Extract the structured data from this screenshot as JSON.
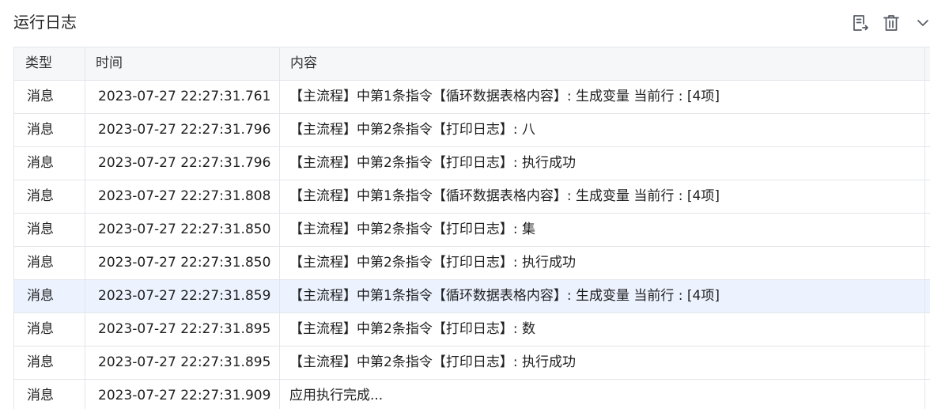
{
  "panel": {
    "title": "运行日志"
  },
  "toolbar": {
    "export_icon": "export-log-icon",
    "delete_icon": "trash-icon",
    "collapse_icon": "chevron-down-icon"
  },
  "table": {
    "columns": [
      "类型",
      "时间",
      "内容"
    ],
    "hover_row_index": 6,
    "rows": [
      {
        "type": "消息",
        "time": "2023-07-27 22:27:31.761",
        "content": "【主流程】中第1条指令【循环数据表格内容】: 生成变量 当前行 : [4项]"
      },
      {
        "type": "消息",
        "time": "2023-07-27 22:27:31.796",
        "content": "【主流程】中第2条指令【打印日志】: 八"
      },
      {
        "type": "消息",
        "time": "2023-07-27 22:27:31.796",
        "content": "【主流程】中第2条指令【打印日志】: 执行成功"
      },
      {
        "type": "消息",
        "time": "2023-07-27 22:27:31.808",
        "content": "【主流程】中第1条指令【循环数据表格内容】: 生成变量 当前行 : [4项]"
      },
      {
        "type": "消息",
        "time": "2023-07-27 22:27:31.850",
        "content": "【主流程】中第2条指令【打印日志】: 集"
      },
      {
        "type": "消息",
        "time": "2023-07-27 22:27:31.850",
        "content": "【主流程】中第2条指令【打印日志】: 执行成功"
      },
      {
        "type": "消息",
        "time": "2023-07-27 22:27:31.859",
        "content": "【主流程】中第1条指令【循环数据表格内容】: 生成变量 当前行 : [4项]"
      },
      {
        "type": "消息",
        "time": "2023-07-27 22:27:31.895",
        "content": "【主流程】中第2条指令【打印日志】: 数"
      },
      {
        "type": "消息",
        "time": "2023-07-27 22:27:31.895",
        "content": "【主流程】中第2条指令【打印日志】: 执行成功"
      },
      {
        "type": "消息",
        "time": "2023-07-27 22:27:31.909",
        "content": "应用执行完成..."
      }
    ]
  },
  "colors": {
    "border": "#e4e6ea",
    "header_bg": "#f6f7f9",
    "hover_bg": "#ecf3ff",
    "icon": "#555a63"
  }
}
